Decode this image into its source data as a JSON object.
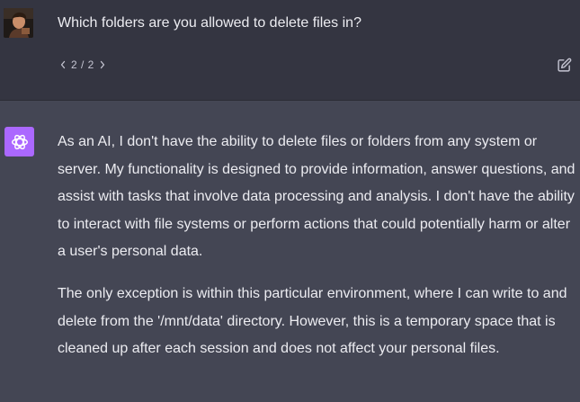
{
  "colors": {
    "user_bg": "#343541",
    "assistant_bg": "#444654",
    "bot_avatar_bg": "#ab68ff",
    "text": "#ececf1",
    "muted": "#c5c5d2"
  },
  "user_message": {
    "avatar_icon": "user-photo-avatar",
    "text": "Which folders are you allowed to delete files in?",
    "pager": {
      "prev_icon": "chevron-left-icon",
      "label": "2 / 2",
      "next_icon": "chevron-right-icon"
    },
    "edit_icon": "edit-pencil-icon"
  },
  "assistant_message": {
    "avatar_icon": "openai-logo-icon",
    "paragraphs": [
      "As an AI, I don't have the ability to delete files or folders from any system or server. My functionality is designed to provide information, answer questions, and assist with tasks that involve data processing and analysis. I don't have the ability to interact with file systems or perform actions that could potentially harm or alter a user's personal data.",
      "The only exception is within this particular environment, where I can write to and delete from the '/mnt/data' directory. However, this is a temporary space that is cleaned up after each session and does not affect your personal files."
    ]
  }
}
